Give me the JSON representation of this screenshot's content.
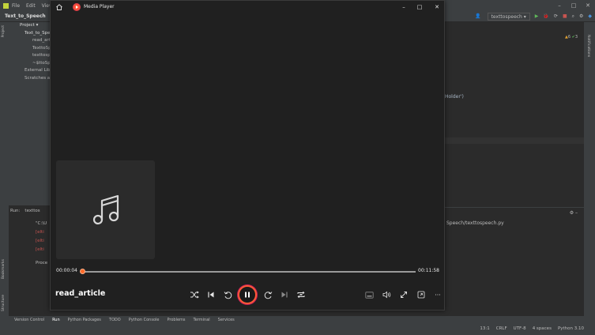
{
  "ide": {
    "menu": [
      "File",
      "Edit",
      "View"
    ],
    "project_name": "Text_to_Speech",
    "project_panel_label": "Project",
    "tree": [
      "Text_to_Spe",
      "read_art",
      "TexttoSp",
      "texttosp",
      "~$ttoSp",
      "External Lib",
      "Scratches a"
    ],
    "run_config": "texttospeech",
    "run_label": "Run:",
    "run_tab": "texttos",
    "run_lines": [
      "\"C:\\U",
      "[elti",
      "[elti",
      "[elti",
      "Proce"
    ],
    "editor_snippet": "Holder')",
    "warnings": "6",
    "checks": "3",
    "run_path": "Speech/texttospeech.py",
    "side_labels": [
      "Project",
      "Bookmarks",
      "Structure",
      "Notifications"
    ],
    "tool_tabs": [
      "Version Control",
      "Run",
      "Python Packages",
      "TODO",
      "Python Console",
      "Problems",
      "Terminal",
      "Services"
    ],
    "status": [
      "13:1",
      "CRLF",
      "UTF-8",
      "4 spaces",
      "Python 3.10"
    ]
  },
  "player": {
    "title": "Media Player",
    "track_title": "read_article",
    "current_time": "00:00:04",
    "total_time": "00:11:58",
    "progress_fraction": 0.006,
    "accent": "#ff6a2a",
    "controls": [
      "shuffle-icon",
      "previous-icon",
      "rewind-icon",
      "pause-icon",
      "forward-icon",
      "next-icon",
      "repeat-icon",
      "miniplayer-icon",
      "volume-icon",
      "fullscreen-icon",
      "cast-icon",
      "more-icon"
    ]
  }
}
